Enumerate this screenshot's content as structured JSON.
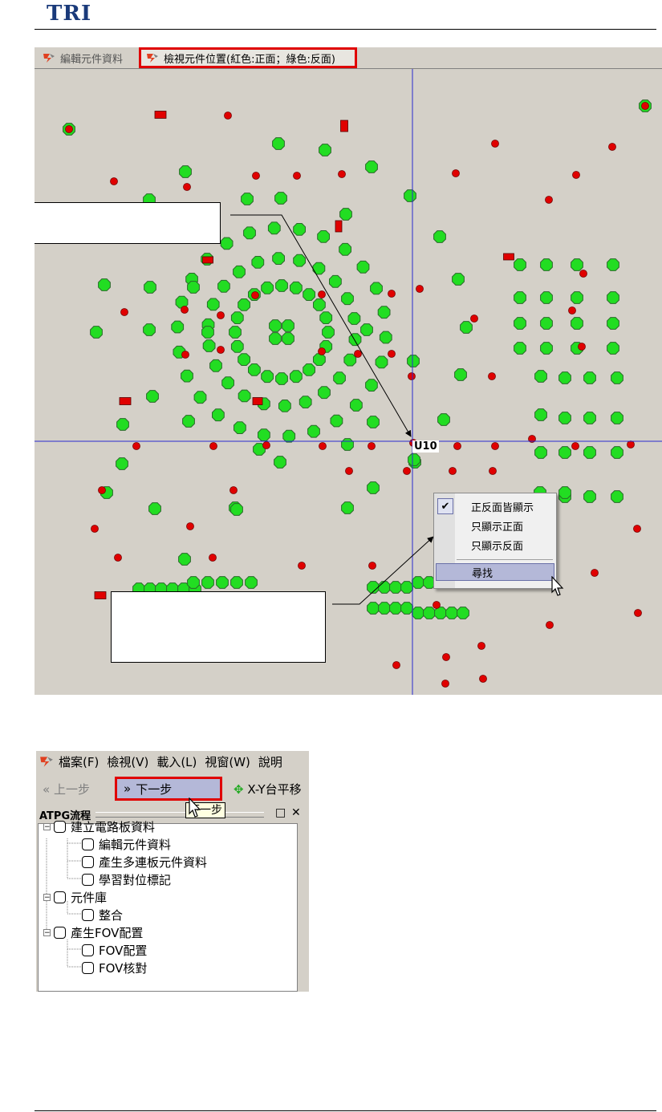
{
  "header": {
    "logo": "TRI"
  },
  "viewer": {
    "tabs": [
      {
        "label": "編輯元件資料",
        "icon": "pcb-app-icon",
        "active": false
      },
      {
        "label": "檢視元件位置(紅色:正面；綠色:反面)",
        "icon": "pcb-app-icon",
        "active": true
      }
    ],
    "component_label": "U10",
    "context_menu": {
      "items": [
        {
          "label": "正反面皆顯示",
          "checked": true
        },
        {
          "label": "只顯示正面",
          "checked": false
        },
        {
          "label": "只顯示反面",
          "checked": false
        },
        {
          "label": "尋找",
          "highlighted": true
        }
      ]
    },
    "colors": {
      "front": "#e00000",
      "back": "#22dd22",
      "crosshair": "#2a2ad0",
      "highlight": "#e00000",
      "menu_highlight": "#b4b8d8"
    }
  },
  "app": {
    "menus": [
      "檔案(F)",
      "檢視(V)",
      "載入(L)",
      "視窗(W)",
      "說明"
    ],
    "toolbar": {
      "prev_label": "上一步",
      "next_label": "下一步",
      "xy_label": "X-Y台平移"
    },
    "tooltip": "下一步",
    "panel": {
      "title": "ATPG流程",
      "pin_glyph": "□",
      "close_glyph": "✕"
    },
    "tree": [
      {
        "label": "建立電路板資料",
        "children": [
          {
            "label": "編輯元件資料"
          },
          {
            "label": "產生多連板元件資料"
          },
          {
            "label": "學習對位標記"
          }
        ]
      },
      {
        "label": "元件庫",
        "children": [
          {
            "label": "整合"
          }
        ]
      },
      {
        "label": "產生FOV配置",
        "children": [
          {
            "label": "FOV配置"
          },
          {
            "label": "FOV核對"
          }
        ]
      }
    ]
  }
}
